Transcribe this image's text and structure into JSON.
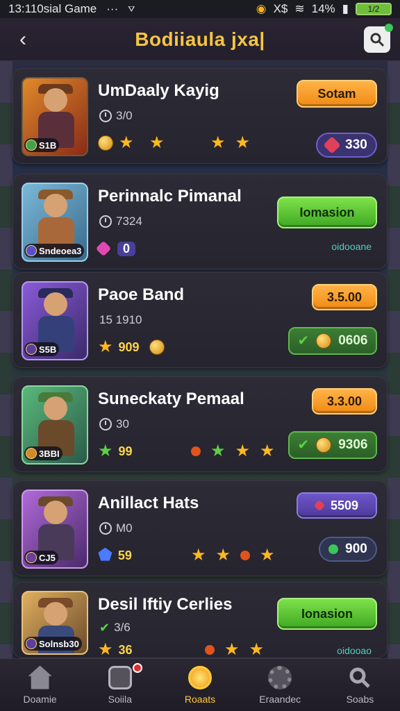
{
  "status_bar": {
    "left_text": "13:110sial Game",
    "dots": "···",
    "battery": "14%",
    "battery_icon_text": "1/2"
  },
  "header": {
    "title": "Bodiiaula jxa|"
  },
  "colors": {
    "accent": "#f5c542",
    "orange_button": "#f08a13",
    "green_button": "#3ea823",
    "purple_button": "#4b3a98"
  },
  "items": [
    {
      "name": "UmDaaly Kayig",
      "sub": "3/0",
      "tag": "S1B",
      "button": "Sotam",
      "pill": "330",
      "thumb_color": "#c8562a"
    },
    {
      "name": "Perinnalc Pimanal",
      "sub": "7324",
      "tag": "Sndeoea3",
      "button": "Iomasion",
      "gem_count": "0",
      "note": "oidooane",
      "thumb_color": "#5c9bc4"
    },
    {
      "name": "Paoe Band",
      "sub": "15 1910",
      "tag": "S5B",
      "button": "3.5.00",
      "coins": "909",
      "pill": "0606",
      "thumb_color": "#6a4cc0"
    },
    {
      "name": "Suneckaty Pemaal",
      "sub": "30",
      "tag": "3BBI",
      "button": "3.3.00",
      "coins": "99",
      "pill": "9306",
      "thumb_color": "#3d8a5a"
    },
    {
      "name": "Anillact Hats",
      "sub": "M0",
      "tag": "CJ5",
      "button": "5509",
      "coins": "59",
      "pill": "900",
      "thumb_color": "#8a4cc0"
    },
    {
      "name": "Desil Iftiy Cerlies",
      "sub": "3/6",
      "tag": "Solnsb30",
      "button": "Ionasion",
      "coins": "36",
      "note": "oidooao",
      "thumb_color": "#c98a3a"
    }
  ],
  "nav": [
    {
      "label": "Doamie",
      "icon": "home-icon"
    },
    {
      "label": "Soiila",
      "icon": "inbox-icon"
    },
    {
      "label": "Roaats",
      "icon": "rewards-icon"
    },
    {
      "label": "Eraandec",
      "icon": "gear-icon"
    },
    {
      "label": "Soabs",
      "icon": "search-icon"
    }
  ]
}
